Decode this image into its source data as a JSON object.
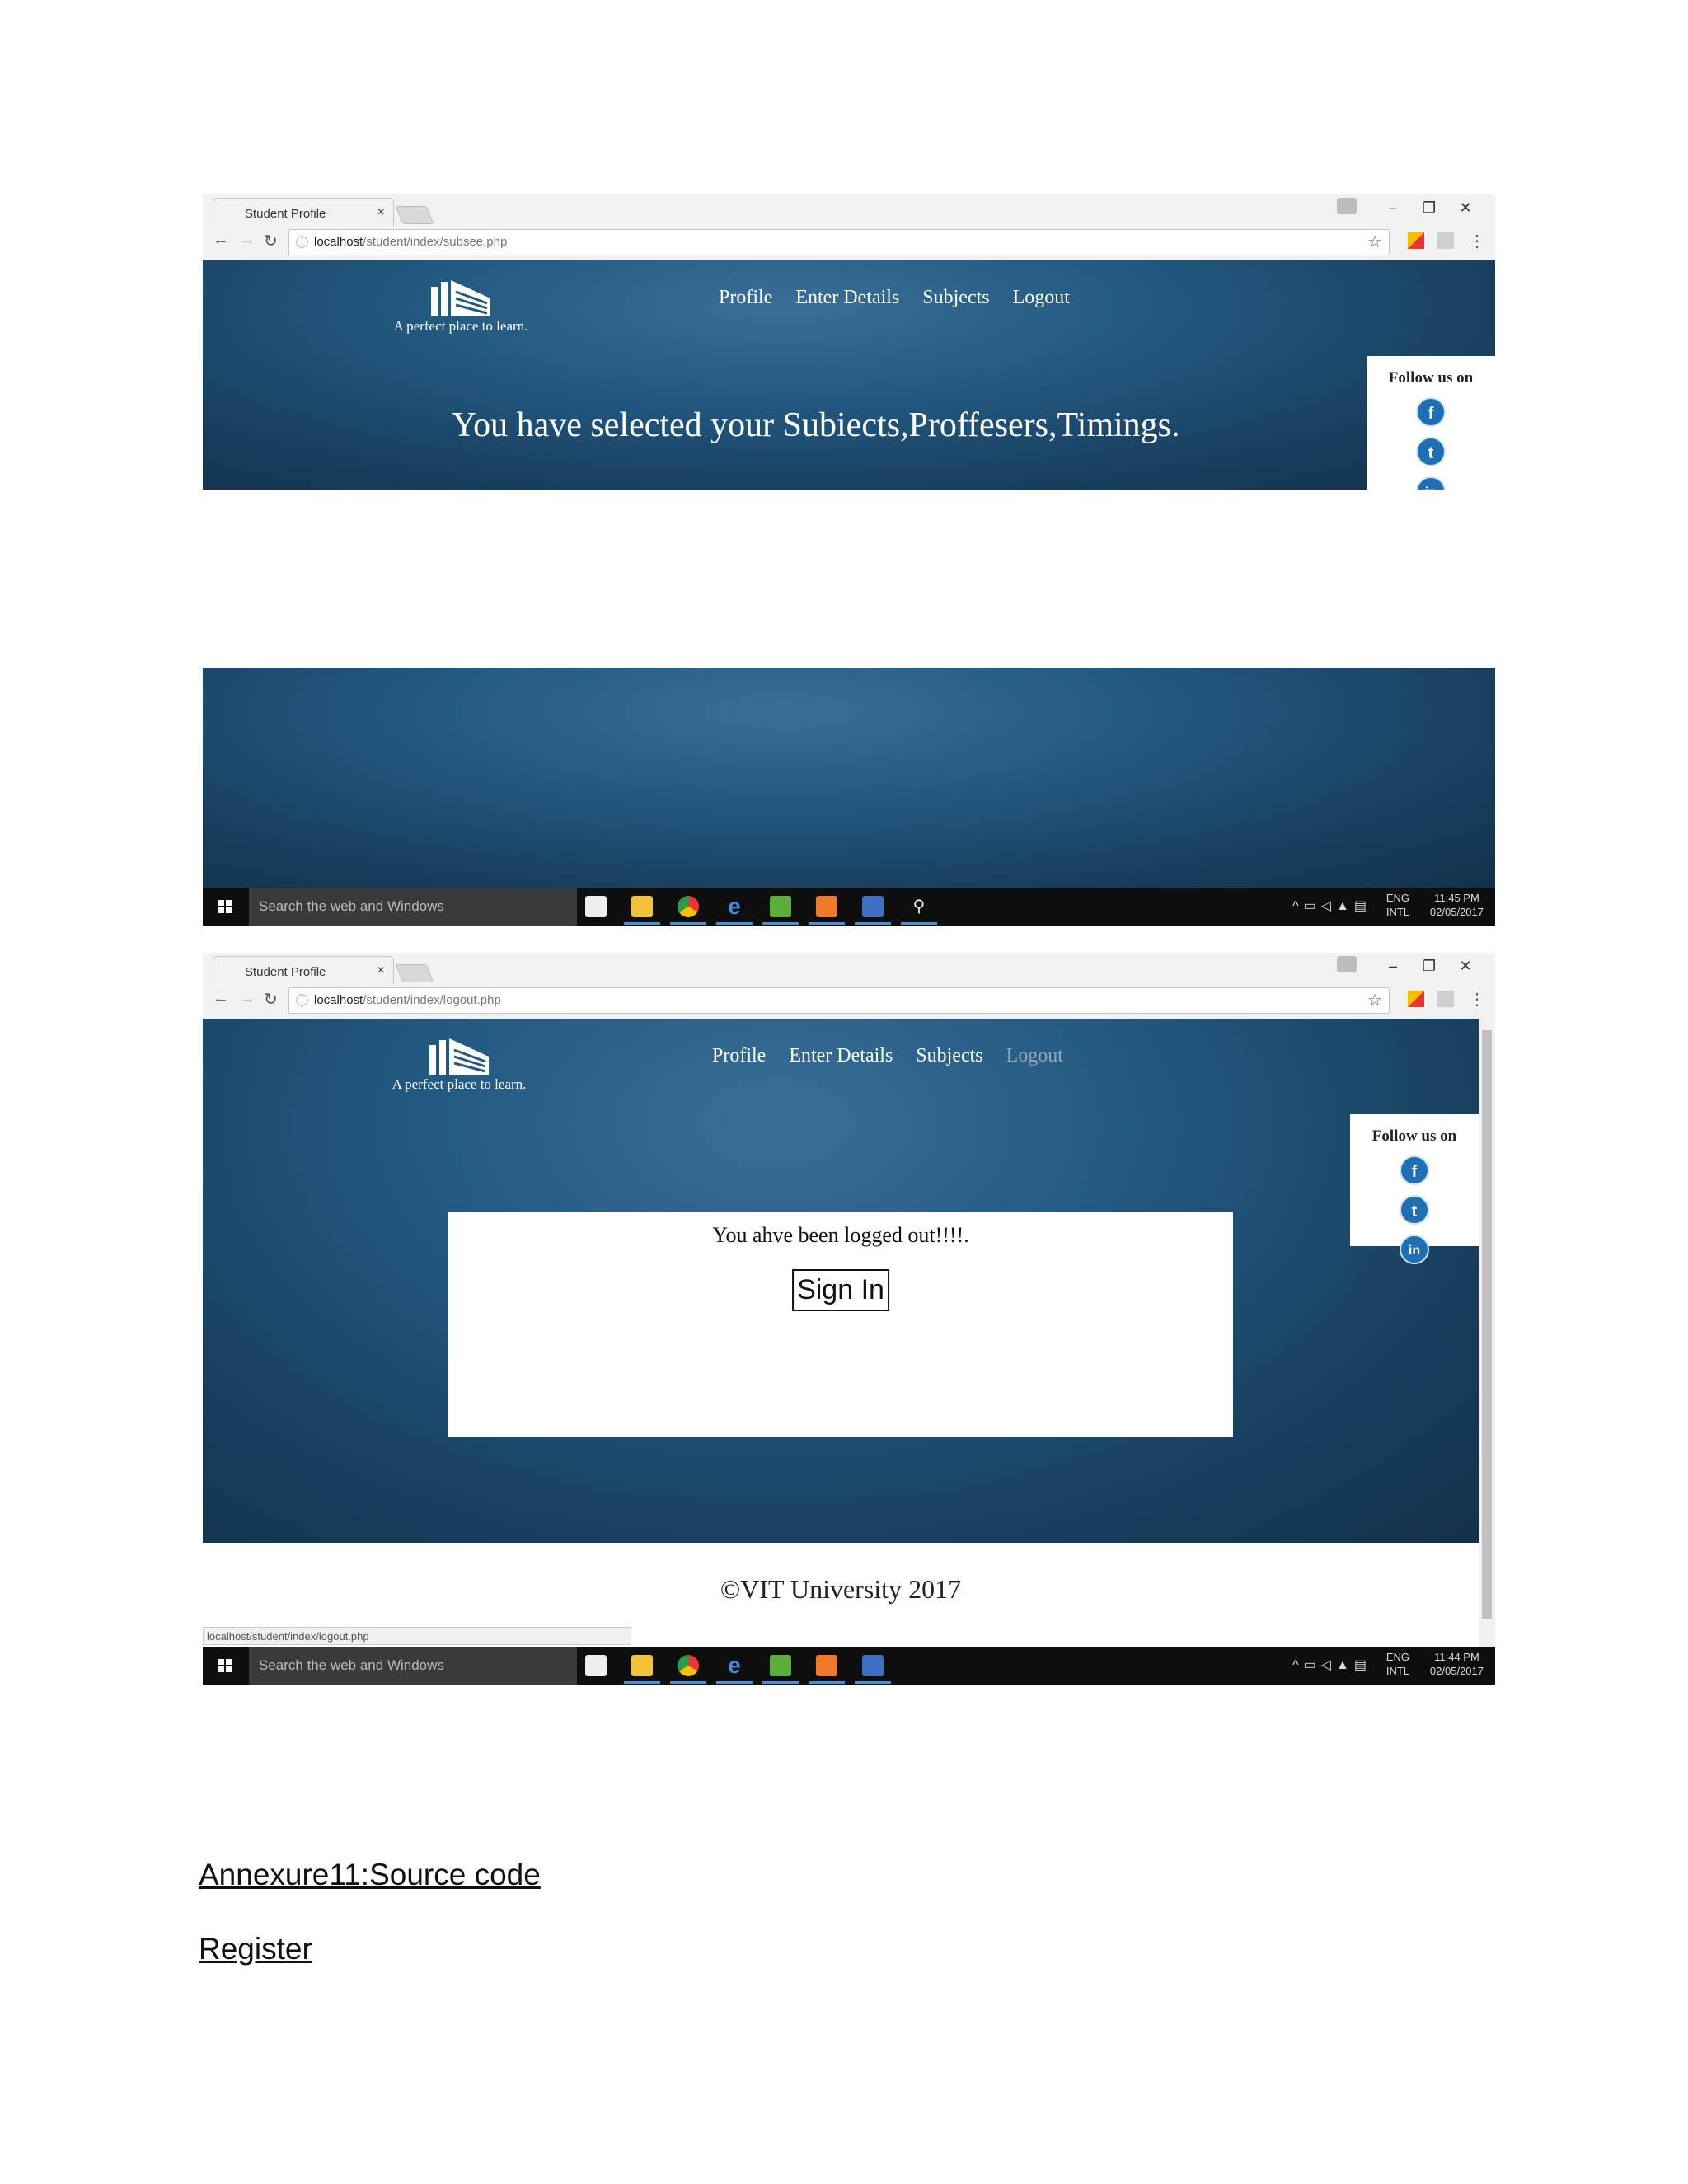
{
  "screenshot1": {
    "tab_title": "Student Profile",
    "tab_close": "×",
    "url_prefix": "localhost",
    "url_path": "/student/index/subsee.php",
    "nav": {
      "back": "←",
      "forward": "→",
      "reload": "C"
    },
    "menu": [
      "Profile",
      "Enter Details",
      "Subjects",
      "Logout"
    ],
    "tagline": "A perfect place to learn.",
    "headline": "You have selected your Subiects,Proffesers,Timings.",
    "follow_title": "Follow us on",
    "social": [
      "f",
      "t",
      "in"
    ]
  },
  "screenshot2": {
    "taskbar": {
      "search_placeholder": "Search the web and Windows",
      "lang_top": "ENG",
      "lang_bottom": "INTL",
      "time": "11:45 PM",
      "date": "02/05/2017"
    }
  },
  "screenshot3": {
    "tab_title": "Student Profile",
    "tab_close": "×",
    "url_prefix": "localhost",
    "url_path": "/student/index/logout.php",
    "menu": [
      "Profile",
      "Enter Details",
      "Subjects",
      "Logout"
    ],
    "tagline": "A perfect place to learn.",
    "follow_title": "Follow us on",
    "social": [
      "f",
      "t",
      "in"
    ],
    "logout_message": "You ahve been logged out!!!!.",
    "signin_label": "Sign In",
    "footer": "©VIT University 2017",
    "status_url": "localhost/student/index/logout.php",
    "taskbar": {
      "search_placeholder": "Search the web and Windows",
      "lang_top": "ENG",
      "lang_bottom": "INTL",
      "time": "11:44 PM",
      "date": "02/05/2017"
    }
  },
  "document": {
    "heading": "Annexure11:Source code",
    "subheading": "Register"
  },
  "colors": {
    "hero_blue": "#235a82",
    "social_blue": "#1f6fb5",
    "taskbar": "#0e0e0e"
  }
}
